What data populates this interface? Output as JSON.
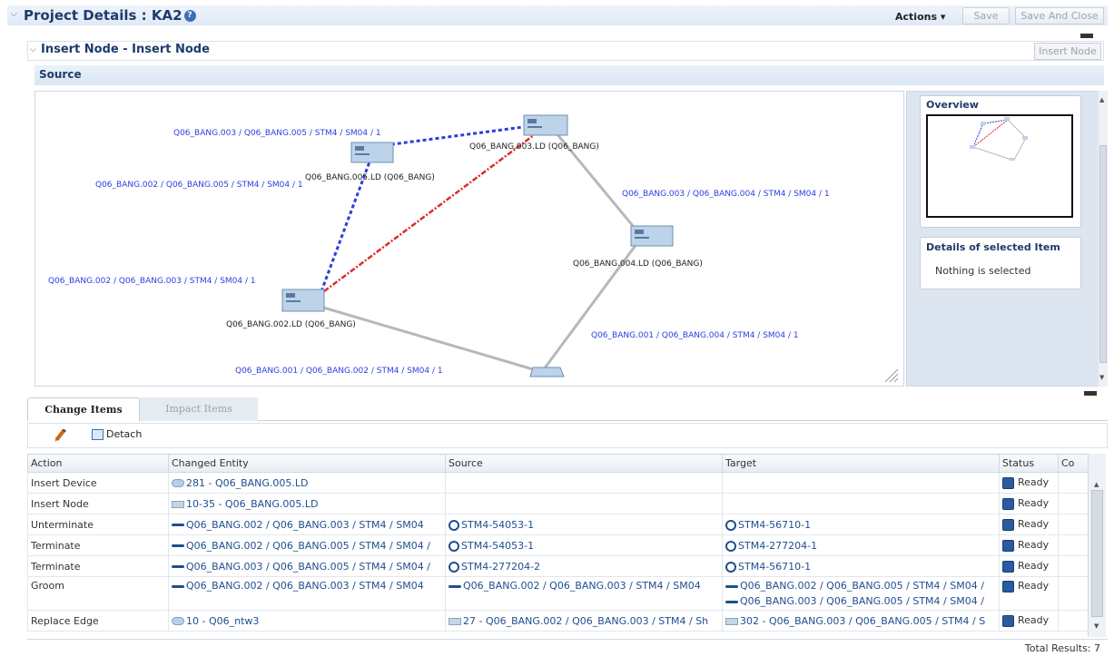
{
  "header": {
    "title": "Project Details : KA2",
    "actions_label": "Actions",
    "save_label": "Save",
    "save_close_label": "Save And Close"
  },
  "sub_header": {
    "title": "Insert Node - Insert Node",
    "insert_node_label": "Insert Node"
  },
  "source_panel": {
    "title": "Source",
    "nodes": [
      {
        "label": "Q06_BANG.003.LD (Q06_BANG)"
      },
      {
        "label": "Q06_BANG.005.LD (Q06_BANG)"
      },
      {
        "label": "Q06_BANG.004.LD (Q06_BANG)"
      },
      {
        "label": "Q06_BANG.002.LD (Q06_BANG)"
      }
    ],
    "links": [
      {
        "label": "Q06_BANG.003 / Q06_BANG.005 / STM4 / SM04 / 1"
      },
      {
        "label": "Q06_BANG.002 / Q06_BANG.005 / STM4 / SM04 / 1"
      },
      {
        "label": "Q06_BANG.003 / Q06_BANG.004 / STM4 / SM04 / 1"
      },
      {
        "label": "Q06_BANG.002 / Q06_BANG.003 / STM4 / SM04 / 1"
      },
      {
        "label": "Q06_BANG.001 / Q06_BANG.004 / STM4 / SM04 / 1"
      },
      {
        "label": "Q06_BANG.001 / Q06_BANG.002 / STM4 / SM04 / 1"
      }
    ],
    "colors": {
      "blue_dash": "#2a3fe0",
      "red_dash": "#e02a2a",
      "gray_link": "#b8b8b8",
      "link_text": "#2a3fe0"
    }
  },
  "overview": {
    "title": "Overview"
  },
  "details": {
    "title": "Details of selected Item",
    "empty_text": "Nothing is selected"
  },
  "tabs": [
    {
      "label": "Change Items"
    },
    {
      "label": "Impact Items"
    }
  ],
  "toolbar": {
    "detach_label": "Detach"
  },
  "table": {
    "columns": [
      "Action",
      "Changed Entity",
      "Source",
      "Target",
      "Status",
      "Co"
    ],
    "rows": [
      {
        "action": "Insert Device",
        "entity": "281 - Q06_BANG.005.LD",
        "source": "",
        "target": "",
        "target2": "",
        "status": "Ready"
      },
      {
        "action": "Insert Node",
        "entity": "10-35 - Q06_BANG.005.LD",
        "source": "",
        "target": "",
        "target2": "",
        "status": "Ready"
      },
      {
        "action": "Unterminate",
        "entity": "Q06_BANG.002 / Q06_BANG.003 / STM4 / SM04",
        "source": "STM4-54053-1",
        "target": "STM4-56710-1",
        "target2": "",
        "status": "Ready"
      },
      {
        "action": "Terminate",
        "entity": "Q06_BANG.002 / Q06_BANG.005 / STM4 / SM04 /",
        "source": "STM4-54053-1",
        "target": "STM4-277204-1",
        "target2": "",
        "status": "Ready"
      },
      {
        "action": "Terminate",
        "entity": "Q06_BANG.003 / Q06_BANG.005 / STM4 / SM04 /",
        "source": "STM4-277204-2",
        "target": "STM4-56710-1",
        "target2": "",
        "status": "Ready"
      },
      {
        "action": "Groom",
        "entity": "Q06_BANG.002 / Q06_BANG.003 / STM4 / SM04",
        "source": "Q06_BANG.002 / Q06_BANG.003 / STM4 / SM04",
        "target": "Q06_BANG.002 / Q06_BANG.005 / STM4 / SM04 /",
        "target2": "Q06_BANG.003 / Q06_BANG.005 / STM4 / SM04 /",
        "status": "Ready"
      },
      {
        "action": "Replace Edge",
        "entity": "10 - Q06_ntw3",
        "source": "27 - Q06_BANG.002 / Q06_BANG.003 / STM4 / Sh",
        "target": "302 - Q06_BANG.003 / Q06_BANG.005 / STM4 / S",
        "target2": "",
        "status": "Ready"
      }
    ]
  },
  "footer": {
    "total_results": "Total Results: 7"
  }
}
